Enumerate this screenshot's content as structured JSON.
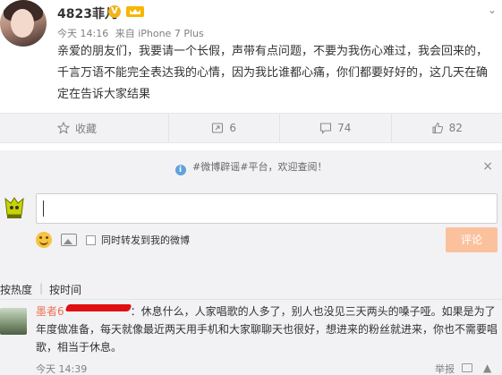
{
  "post": {
    "username": "4823菲儿",
    "verified_badge": "V",
    "time": "今天 14:16",
    "source": "来自 iPhone 7 Plus",
    "content": "亲爱的朋友们，我要请一个长假，声带有点问题，不要为我伤心难过，我会回来的，千言万语不能完全表达我的心情，因为我比谁都心痛，你们都要好好的，这几天在确定在告诉大家结果"
  },
  "actions": [
    {
      "icon": "star-icon",
      "label": "收藏"
    },
    {
      "icon": "share-icon",
      "label": "6"
    },
    {
      "icon": "comment-icon",
      "label": "74"
    },
    {
      "icon": "thumbs-up-icon",
      "label": "82"
    }
  ],
  "comment_box": {
    "tip": "#微博辟谣#平台，欢迎查阅！",
    "close": "×",
    "repost_label": "同时转发到我的微博",
    "submit_label": "评论"
  },
  "sort": {
    "by_hot": "按热度",
    "separator": "|",
    "by_time": "按时间"
  },
  "comments": [
    {
      "name": "墨者6",
      "text": "：休息什么，人家唱歌的人多了，别人也没见三天两头的嗓子哑。如果是为了年度做准备，每天就像最近两天用手机和大家聊聊天也很好，想进来的粉丝就进来，你也不需要唱歌，相当于休息。",
      "time": "今天 14:39",
      "report": "举报"
    }
  ],
  "colors": {
    "accent": "#eb7350",
    "submit_disabled": "#fbc19d",
    "background_gray": "#f2f2f5",
    "badge_gold": "#f2b41a",
    "redaction": "#e01010"
  }
}
